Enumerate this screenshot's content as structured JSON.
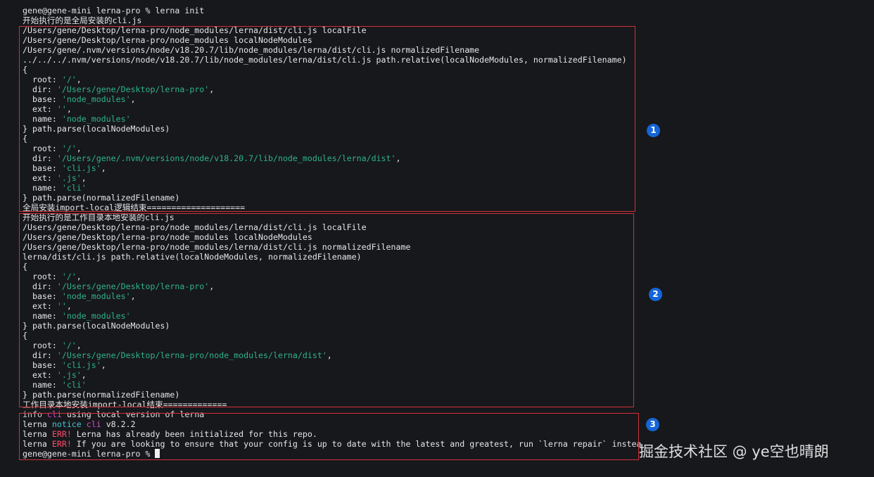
{
  "terminal": {
    "lines": [
      [
        {
          "t": "gene@gene-mini lerna-pro % lerna init"
        }
      ],
      [
        {
          "t": "开始执行的是全局安装的cli.js"
        }
      ],
      [
        {
          "t": "/Users/gene/Desktop/lerna-pro/node_modules/lerna/dist/cli.js localFile"
        }
      ],
      [
        {
          "t": "/Users/gene/Desktop/lerna-pro/node_modules localNodeModules"
        }
      ],
      [
        {
          "t": "/Users/gene/.nvm/versions/node/v18.20.7/lib/node_modules/lerna/dist/cli.js normalizedFilename"
        }
      ],
      [
        {
          "t": "../../../.nvm/versions/node/v18.20.7/lib/node_modules/lerna/dist/cli.js path.relative(localNodeModules, normalizedFilename)"
        }
      ],
      [
        {
          "t": "{"
        }
      ],
      [
        {
          "t": "  root: "
        },
        {
          "t": "'/'",
          "c": "str"
        },
        {
          "t": ","
        }
      ],
      [
        {
          "t": "  dir: "
        },
        {
          "t": "'/Users/gene/Desktop/lerna-pro'",
          "c": "str"
        },
        {
          "t": ","
        }
      ],
      [
        {
          "t": "  base: "
        },
        {
          "t": "'node_modules'",
          "c": "str"
        },
        {
          "t": ","
        }
      ],
      [
        {
          "t": "  ext: "
        },
        {
          "t": "''",
          "c": "str"
        },
        {
          "t": ","
        }
      ],
      [
        {
          "t": "  name: "
        },
        {
          "t": "'node_modules'",
          "c": "str"
        }
      ],
      [
        {
          "t": "} path.parse(localNodeModules)"
        }
      ],
      [
        {
          "t": "{"
        }
      ],
      [
        {
          "t": "  root: "
        },
        {
          "t": "'/'",
          "c": "str"
        },
        {
          "t": ","
        }
      ],
      [
        {
          "t": "  dir: "
        },
        {
          "t": "'/Users/gene/.nvm/versions/node/v18.20.7/lib/node_modules/lerna/dist'",
          "c": "str"
        },
        {
          "t": ","
        }
      ],
      [
        {
          "t": "  base: "
        },
        {
          "t": "'cli.js'",
          "c": "str"
        },
        {
          "t": ","
        }
      ],
      [
        {
          "t": "  ext: "
        },
        {
          "t": "'.js'",
          "c": "str"
        },
        {
          "t": ","
        }
      ],
      [
        {
          "t": "  name: "
        },
        {
          "t": "'cli'",
          "c": "str"
        }
      ],
      [
        {
          "t": "} path.parse(normalizedFilename)"
        }
      ],
      [
        {
          "t": "全局安装import-local逻辑结束===================="
        }
      ],
      [
        {
          "t": "开始执行的是工作目录本地安装的cli.js"
        }
      ],
      [
        {
          "t": "/Users/gene/Desktop/lerna-pro/node_modules/lerna/dist/cli.js localFile"
        }
      ],
      [
        {
          "t": "/Users/gene/Desktop/lerna-pro/node_modules localNodeModules"
        }
      ],
      [
        {
          "t": "/Users/gene/Desktop/lerna-pro/node_modules/lerna/dist/cli.js normalizedFilename"
        }
      ],
      [
        {
          "t": "lerna/dist/cli.js path.relative(localNodeModules, normalizedFilename)"
        }
      ],
      [
        {
          "t": "{"
        }
      ],
      [
        {
          "t": "  root: "
        },
        {
          "t": "'/'",
          "c": "str"
        },
        {
          "t": ","
        }
      ],
      [
        {
          "t": "  dir: "
        },
        {
          "t": "'/Users/gene/Desktop/lerna-pro'",
          "c": "str"
        },
        {
          "t": ","
        }
      ],
      [
        {
          "t": "  base: "
        },
        {
          "t": "'node_modules'",
          "c": "str"
        },
        {
          "t": ","
        }
      ],
      [
        {
          "t": "  ext: "
        },
        {
          "t": "''",
          "c": "str"
        },
        {
          "t": ","
        }
      ],
      [
        {
          "t": "  name: "
        },
        {
          "t": "'node_modules'",
          "c": "str"
        }
      ],
      [
        {
          "t": "} path.parse(localNodeModules)"
        }
      ],
      [
        {
          "t": "{"
        }
      ],
      [
        {
          "t": "  root: "
        },
        {
          "t": "'/'",
          "c": "str"
        },
        {
          "t": ","
        }
      ],
      [
        {
          "t": "  dir: "
        },
        {
          "t": "'/Users/gene/Desktop/lerna-pro/node_modules/lerna/dist'",
          "c": "str"
        },
        {
          "t": ","
        }
      ],
      [
        {
          "t": "  base: "
        },
        {
          "t": "'cli.js'",
          "c": "str"
        },
        {
          "t": ","
        }
      ],
      [
        {
          "t": "  ext: "
        },
        {
          "t": "'.js'",
          "c": "str"
        },
        {
          "t": ","
        }
      ],
      [
        {
          "t": "  name: "
        },
        {
          "t": "'cli'",
          "c": "str"
        }
      ],
      [
        {
          "t": "} path.parse(normalizedFilename)"
        }
      ],
      [
        {
          "t": "工作目录本地安装import-local结束============="
        }
      ],
      [
        {
          "t": "info",
          "c": "ind"
        },
        {
          "t": " "
        },
        {
          "t": "cli",
          "c": "mag"
        },
        {
          "t": " using local version of lerna"
        }
      ],
      [
        {
          "t": "lerna "
        },
        {
          "t": "notice",
          "c": "cyan"
        },
        {
          "t": " "
        },
        {
          "t": "cli",
          "c": "mag"
        },
        {
          "t": " v8.2.2"
        }
      ],
      [
        {
          "t": "lerna "
        },
        {
          "t": "ERR!",
          "c": "red"
        },
        {
          "t": " Lerna has already been initialized for this repo."
        }
      ],
      [
        {
          "t": "lerna "
        },
        {
          "t": "ERR!",
          "c": "red"
        },
        {
          "t": " If you are looking to ensure that your config is up to date with the latest and greatest, run `lerna repair` instead"
        }
      ],
      [
        {
          "t": "gene@gene-mini lerna-pro % "
        },
        {
          "cursor": true
        }
      ]
    ]
  },
  "annotations": [
    {
      "label": "1"
    },
    {
      "label": "2"
    },
    {
      "label": "3"
    }
  ],
  "watermark": "掘金技术社区 @ ye空也晴朗",
  "colors": {
    "background": "#17181c",
    "text": "#e6e6e6",
    "string": "#2eb38a",
    "notice": "#44c2d4",
    "cli": "#d24ccf",
    "error": "#ff4b6b",
    "box": "#d0313a",
    "badge": "#1565d8"
  }
}
